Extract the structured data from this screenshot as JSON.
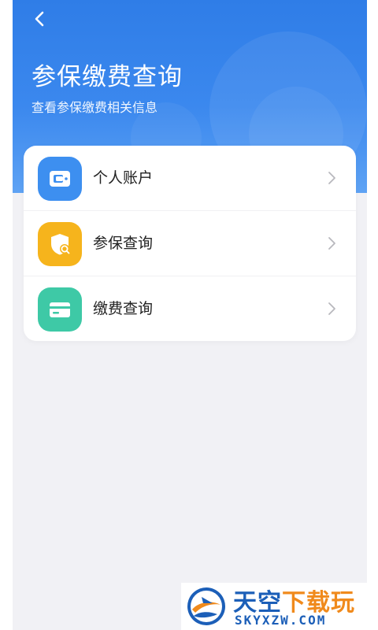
{
  "header": {
    "title": "参保缴费查询",
    "subtitle": "查看参保缴费相关信息",
    "back_icon": "chevron-left-icon"
  },
  "menu": [
    {
      "label": "个人账户",
      "icon": "wallet-icon",
      "color": "#3d8ff0"
    },
    {
      "label": "参保查询",
      "icon": "shield-search-icon",
      "color": "#f6b41c"
    },
    {
      "label": "缴费查询",
      "icon": "card-icon",
      "color": "#3ec9a6"
    }
  ],
  "watermark": {
    "brand_main": "天空",
    "brand_accent": "下载玩",
    "site": "SKYXZW.COM"
  },
  "colors": {
    "hero_blue": "#2f7de7",
    "background": "#f1f1f5",
    "chevron": "#b8b8bd"
  }
}
